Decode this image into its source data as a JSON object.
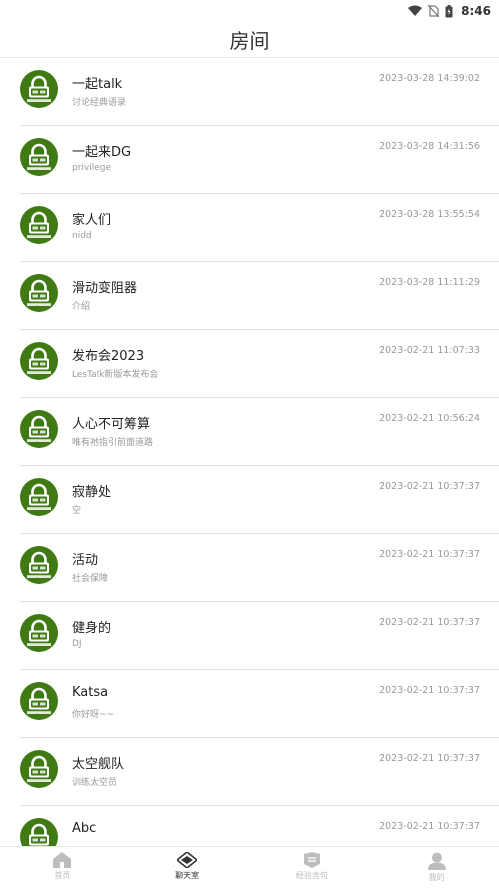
{
  "status_bar": {
    "time": "8:46"
  },
  "header": {
    "title": "房间"
  },
  "rooms": [
    {
      "name": "一起talk",
      "desc": "讨论经典语录",
      "time": "2023-03-28 14:39:02"
    },
    {
      "name": "一起来DG",
      "desc": "privilege",
      "time": "2023-03-28 14:31:56"
    },
    {
      "name": "家人们",
      "desc": "nidd",
      "time": "2023-03-28 13:55:54"
    },
    {
      "name": "滑动变阻器",
      "desc": "介绍",
      "time": "2023-03-28 11:11:29"
    },
    {
      "name": "发布会2023",
      "desc": "LesTalk新版本发布会",
      "time": "2023-02-21 11:07:33"
    },
    {
      "name": "人心不可筹算",
      "desc": "唯有祂指引前面道路",
      "time": "2023-02-21 10:56:24"
    },
    {
      "name": "寂静处",
      "desc": "空",
      "time": "2023-02-21 10:37:37"
    },
    {
      "name": "活动",
      "desc": "社会保障",
      "time": "2023-02-21 10:37:37"
    },
    {
      "name": "健身的",
      "desc": "DJ",
      "time": "2023-02-21 10:37:37"
    },
    {
      "name": "Katsa",
      "desc": "你好呀~~",
      "time": "2023-02-21 10:37:37"
    },
    {
      "name": "太空舰队",
      "desc": "训练太空员",
      "time": "2023-02-21 10:37:37"
    },
    {
      "name": "Abc",
      "desc": "",
      "time": "2023-02-21 10:37:37"
    }
  ],
  "tabs": [
    {
      "label": "首页",
      "icon": "home-icon",
      "active": false
    },
    {
      "label": "聊天室",
      "icon": "chat-room-icon",
      "active": true
    },
    {
      "label": "经验含句",
      "icon": "book-icon",
      "active": false
    },
    {
      "label": "我的",
      "icon": "user-icon",
      "active": false
    }
  ],
  "colors": {
    "avatar_green": "#3f7a12",
    "divider": "#e0e0e0",
    "muted_text": "#999999"
  }
}
